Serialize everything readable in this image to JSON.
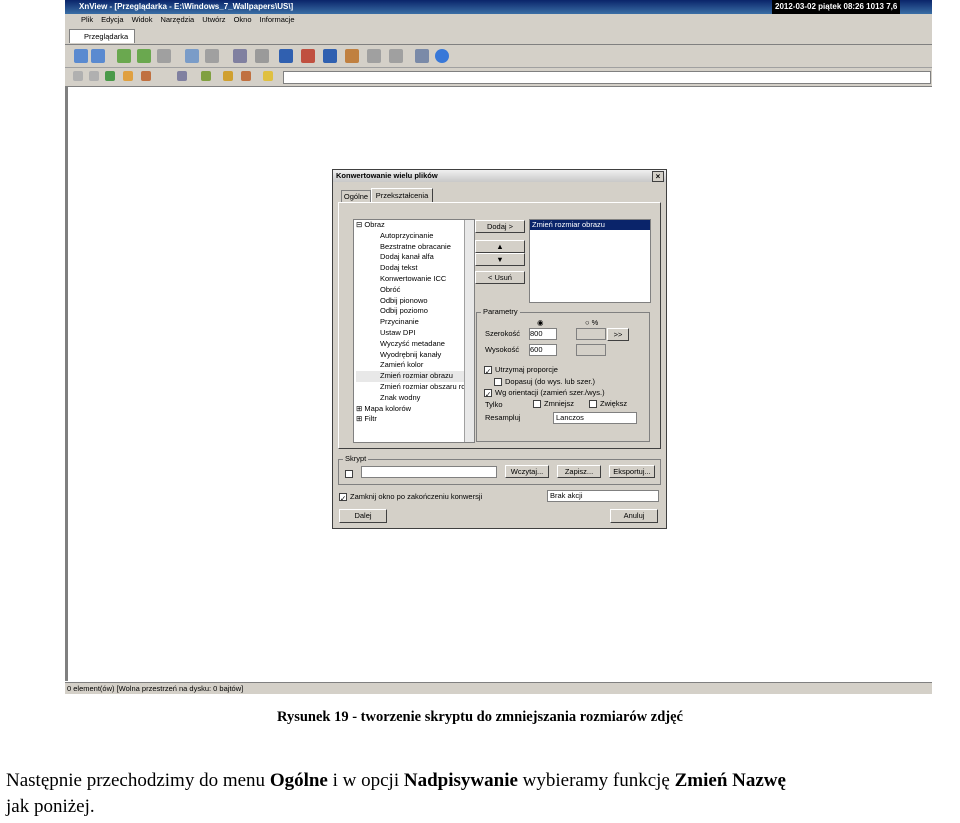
{
  "app": {
    "title": "XnView - [Przeglądarka - E:\\Windows_7_Wallpapers\\US\\]",
    "clock": "2012-03-02 piątek 08:26 1013 7,6",
    "menu": [
      "Plik",
      "Edycja",
      "Widok",
      "Narzędzia",
      "Utwórz",
      "Okno",
      "Informacje"
    ],
    "tab": "Przeglądarka",
    "status": "0 element(ów) [Wolna przestrzeń na dysku: 0 bajtów]"
  },
  "dialog": {
    "title": "Konwertowanie wielu plików",
    "tabs": [
      "Ogólne",
      "Przekształcenia"
    ],
    "tree_root": "Obraz",
    "tree_items": [
      "Autoprzycinanie",
      "Bezstratne obracanie",
      "Dodaj kanał alfa",
      "Dodaj tekst",
      "Konwertowanie ICC",
      "Obróć",
      "Odbij pionowo",
      "Odbij poziomo",
      "Przycinanie",
      "Ustaw DPI",
      "Wyczyść metadane",
      "Wyodrębnij kanały",
      "Zamień kolor",
      "Zmień rozmiar obrazu",
      "Zmień rozmiar obszaru rob",
      "Znak wodny"
    ],
    "tree_more": [
      "Mapa kolorów",
      "Filtr"
    ],
    "add_button": "Dodaj >",
    "up_button": "▲",
    "down_button": "▼",
    "remove_button": "< Usuń",
    "list_selected": "Zmień rozmiar obrazu",
    "params_label": "Parametry",
    "percent_label": "%",
    "width_label": "Szerokość",
    "width_value": "800",
    "height_label": "Wysokość",
    "height_value": "600",
    "arrow_button": ">>",
    "keep_ratio": "Utrzymaj proporcje",
    "fit": "Dopasuj (do wys. lub szer.)",
    "orientation": "Wg orientacji (zamień szer./wys.)",
    "only_label": "Tylko",
    "smaller": "Zmniejsz",
    "larger": "Zwiększ",
    "resample_label": "Resampluj",
    "resample_value": "Lanczos",
    "script_label": "Skrypt",
    "load_button": "Wczytaj...",
    "save_button": "Zapisz...",
    "export_button": "Eksportuj...",
    "close_after": "Zamknij okno po zakończeniu konwersji",
    "action_value": "Brak akcji",
    "next_button": "Dalej",
    "cancel_button": "Anuluj"
  },
  "caption": "Rysunek 19 - tworzenie skryptu do zmniejszania rozmiarów zdjęć",
  "paragraph": {
    "p1": "Następnie przechodzimy do menu ",
    "b1": "Ogólne",
    "p2": " i w opcji ",
    "b2": "Nadpisywanie",
    "p3": " wybieramy funkcję ",
    "b3": "Zmień Nazwę",
    "p4": "jak poniżej."
  }
}
